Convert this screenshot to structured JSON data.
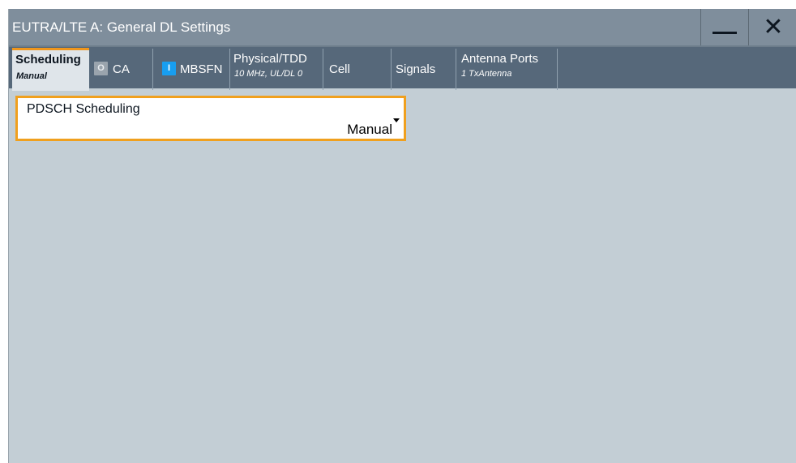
{
  "window": {
    "title": "EUTRA/LTE A: General DL Settings",
    "minimize_icon": "minimize-icon",
    "close_icon": "close-icon",
    "close_glyph": "✕"
  },
  "tabs": {
    "scheduling": {
      "label": "Scheduling",
      "sub": "Manual",
      "active": true
    },
    "ca": {
      "label": "CA",
      "indicator": "O",
      "state": "off"
    },
    "mbsfn": {
      "label": "MBSFN",
      "indicator": "I",
      "state": "on"
    },
    "physical": {
      "label": "Physical/TDD",
      "sub": "10 MHz, UL/DL 0"
    },
    "cell": {
      "label": "Cell"
    },
    "signals": {
      "label": "Signals"
    },
    "antenna": {
      "label": "Antenna Ports",
      "sub": "1 TxAntenna"
    }
  },
  "pdsch": {
    "label": "PDSCH Scheduling",
    "value": "Manual",
    "icon": "dropdown-caret-icon"
  },
  "colors": {
    "accent": "#f0961c",
    "titlebar": "#7f8e9c",
    "tabbar": "#56687a",
    "content": "#c3ced5",
    "on_indicator": "#189ef0"
  }
}
